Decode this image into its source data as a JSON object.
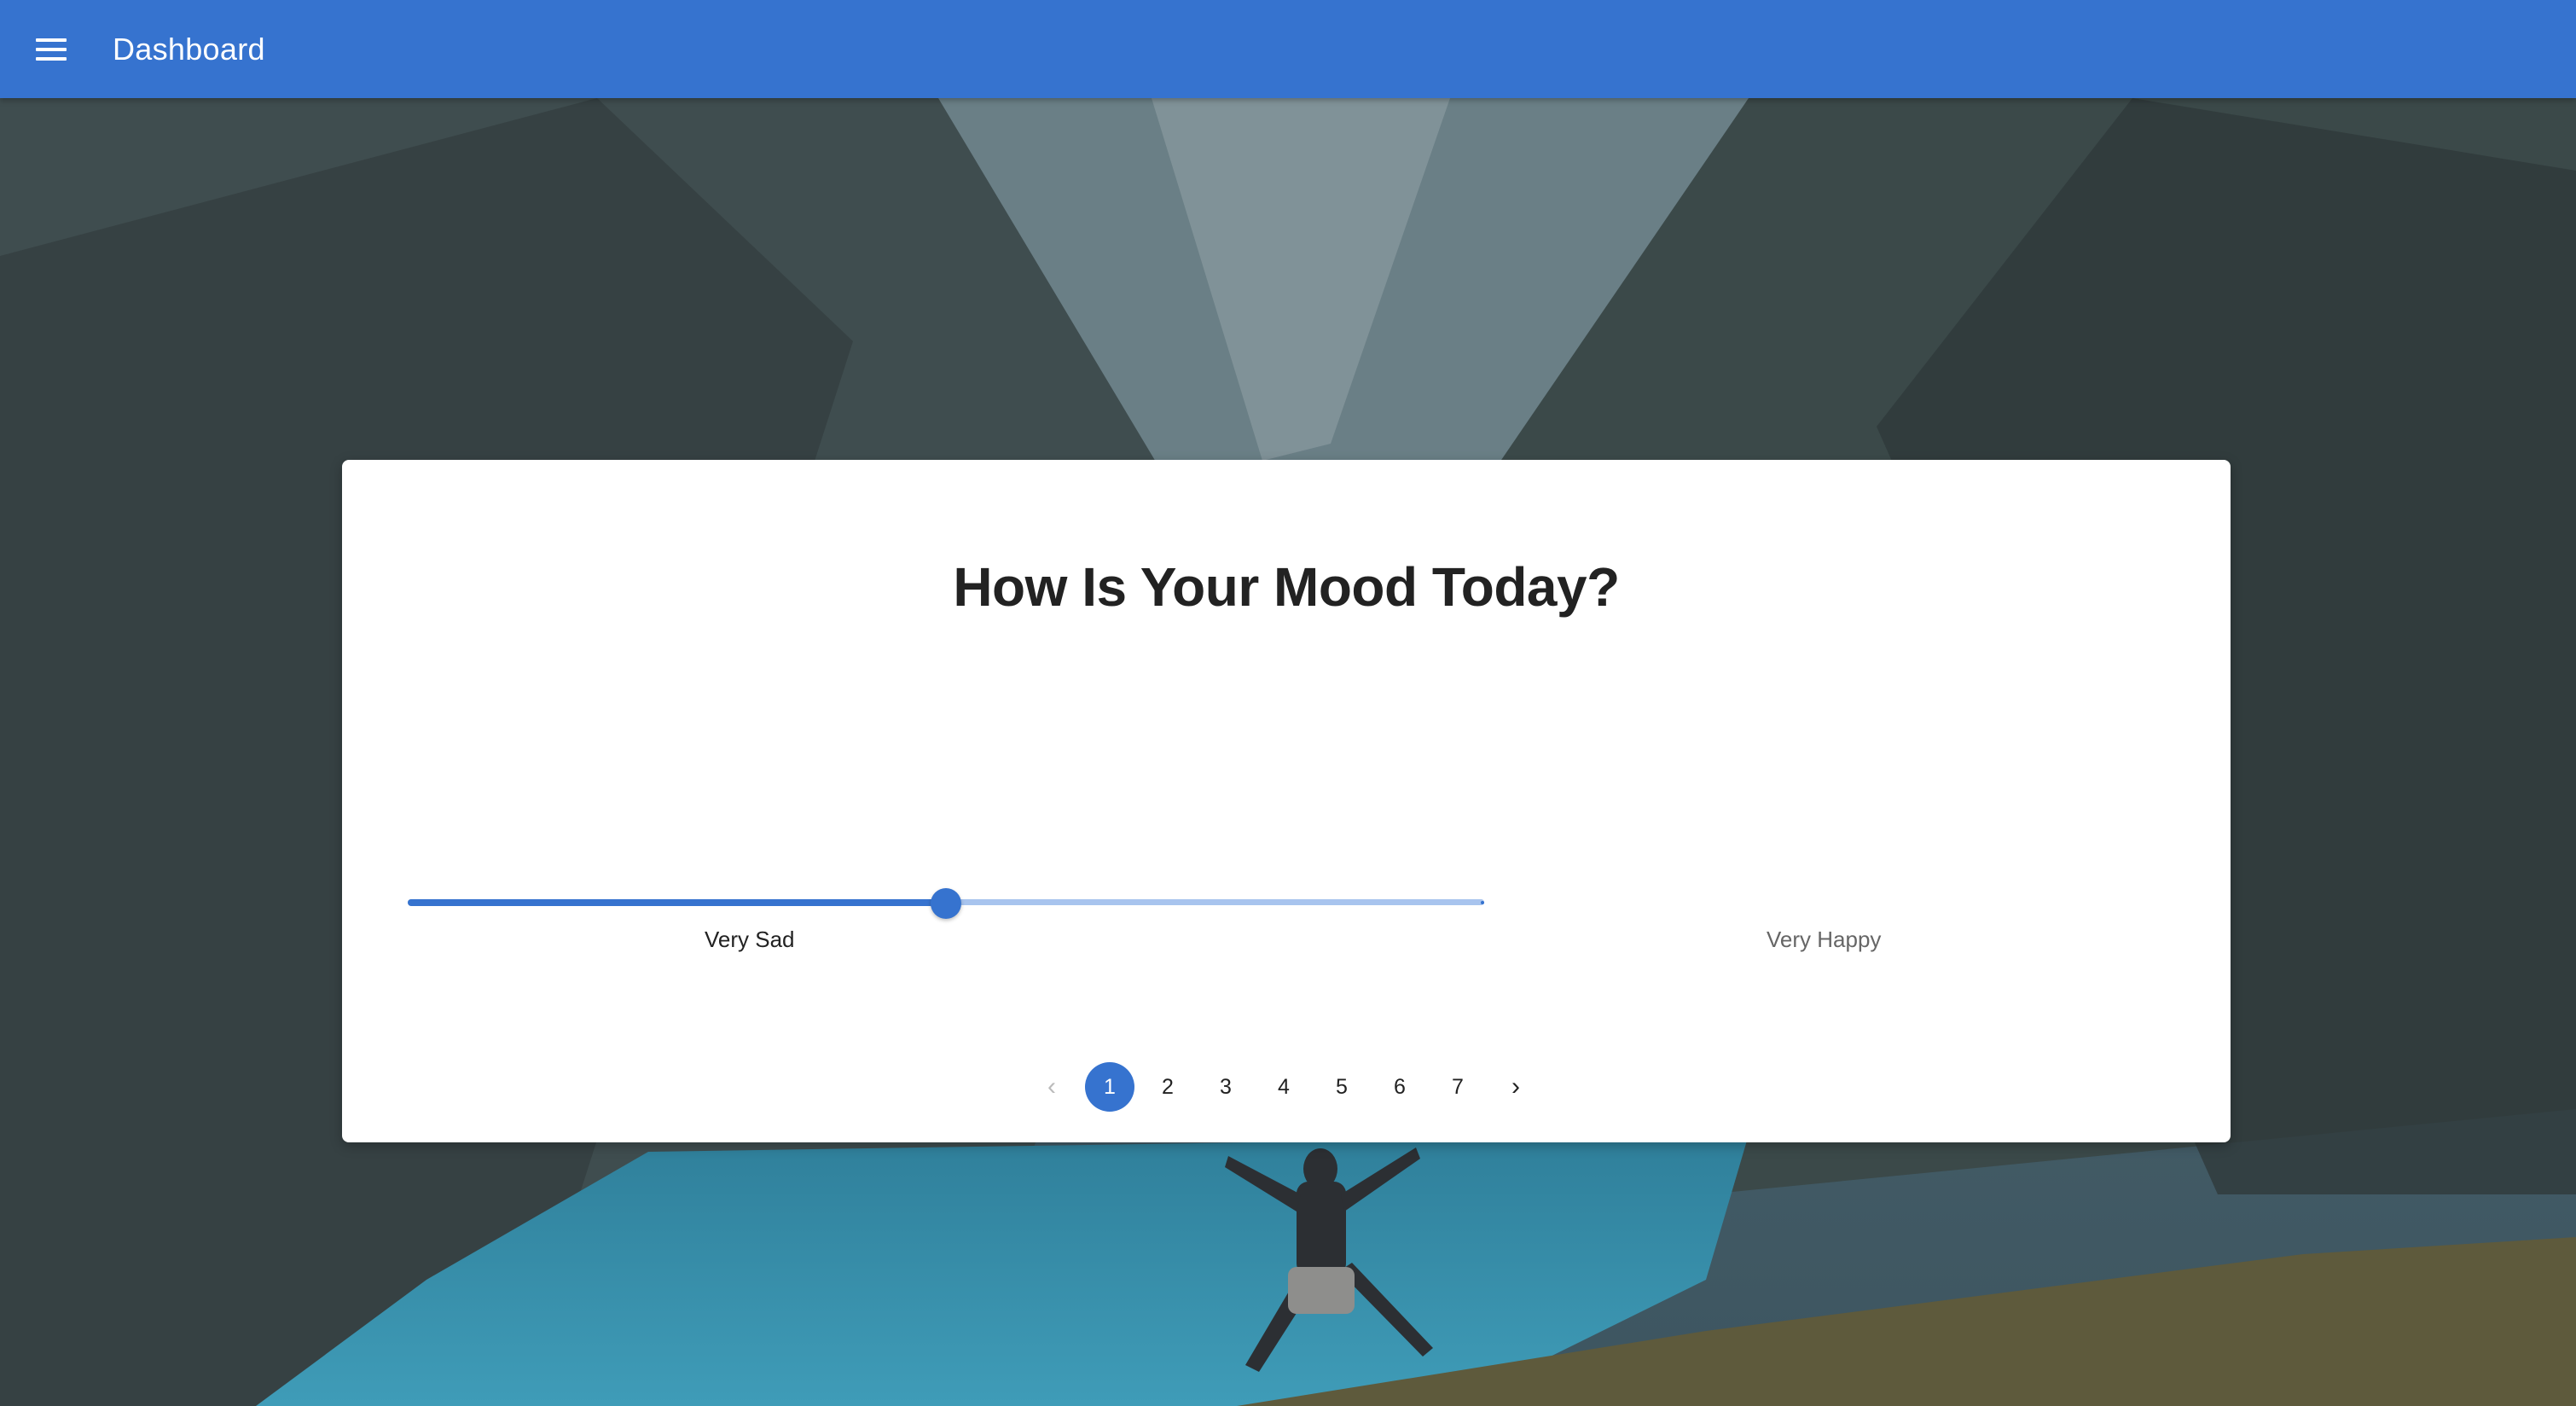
{
  "appbar": {
    "title": "Dashboard",
    "menu_icon": "menu-icon",
    "color": "#3673cf"
  },
  "card": {
    "title": "How Is Your Mood Today?"
  },
  "mood_slider": {
    "value_fraction": 0.5,
    "min_label": "Very Sad",
    "max_label": "Very Happy",
    "color": "#3673cf"
  },
  "pagination": {
    "prev_icon": "chevron-left-icon",
    "next_icon": "chevron-right-icon",
    "current_page": "1",
    "pages": [
      "1",
      "2",
      "3",
      "4",
      "5",
      "6",
      "7"
    ]
  }
}
